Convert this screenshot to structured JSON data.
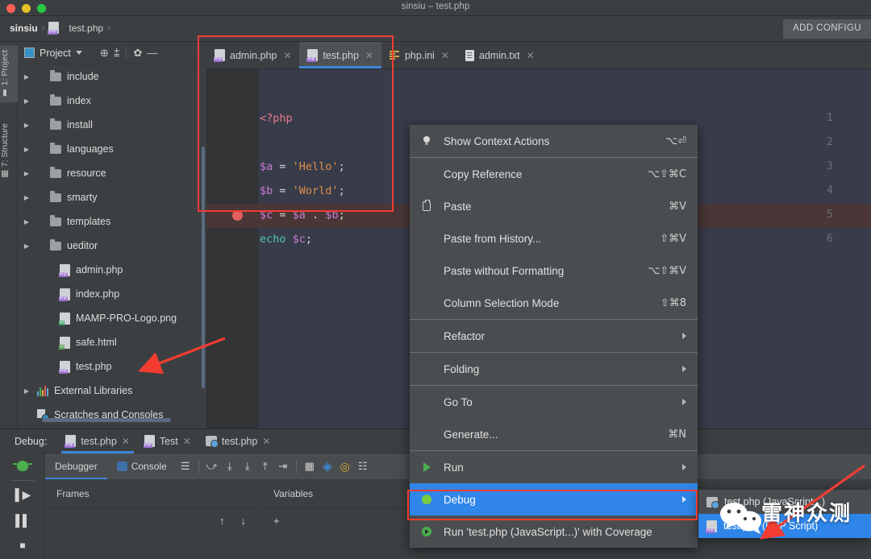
{
  "window": {
    "title": "sinsiu – test.php"
  },
  "breadcrumb": {
    "project": "sinsiu",
    "file": "test.php",
    "separator": "›"
  },
  "toolbar": {
    "add_configuration": "ADD CONFIGU"
  },
  "left_tool_strip": {
    "tabs": [
      {
        "label": "1: Project"
      },
      {
        "label": "7: Structure"
      }
    ]
  },
  "project_panel": {
    "title": "Project",
    "tree": [
      {
        "label": "include",
        "type": "folder",
        "expandable": true
      },
      {
        "label": "index",
        "type": "folder",
        "expandable": true
      },
      {
        "label": "install",
        "type": "folder",
        "expandable": true
      },
      {
        "label": "languages",
        "type": "folder",
        "expandable": true
      },
      {
        "label": "resource",
        "type": "folder",
        "expandable": true
      },
      {
        "label": "smarty",
        "type": "folder",
        "expandable": true
      },
      {
        "label": "templates",
        "type": "folder",
        "expandable": true
      },
      {
        "label": "ueditor",
        "type": "folder",
        "expandable": true
      },
      {
        "label": "admin.php",
        "type": "php",
        "expandable": false
      },
      {
        "label": "index.php",
        "type": "php",
        "expandable": false
      },
      {
        "label": "MAMP-PRO-Logo.png",
        "type": "png",
        "expandable": false
      },
      {
        "label": "safe.html",
        "type": "html",
        "expandable": false
      },
      {
        "label": "test.php",
        "type": "php",
        "expandable": false
      },
      {
        "label": "External Libraries",
        "type": "library",
        "expandable": true
      },
      {
        "label": "Scratches and Consoles",
        "type": "scratch",
        "expandable": false
      }
    ]
  },
  "editor": {
    "tabs": [
      {
        "label": "admin.php",
        "type": "php",
        "active": false
      },
      {
        "label": "test.php",
        "type": "php",
        "active": true
      },
      {
        "label": "php.ini",
        "type": "ini",
        "active": false
      },
      {
        "label": "admin.txt",
        "type": "txt",
        "active": false
      }
    ],
    "line_numbers": [
      "1",
      "2",
      "3",
      "4",
      "5",
      "6"
    ],
    "breakpoint_line": 5,
    "current_line": 5,
    "code": [
      {
        "n": "1",
        "tokens": [
          {
            "t": "<?php",
            "c": "tag"
          }
        ]
      },
      {
        "n": "2",
        "tokens": []
      },
      {
        "n": "3",
        "tokens": [
          {
            "t": "$a",
            "c": "var"
          },
          {
            "t": " = ",
            "c": "op"
          },
          {
            "t": "'Hello'",
            "c": "str"
          },
          {
            "t": ";",
            "c": "def"
          }
        ]
      },
      {
        "n": "4",
        "tokens": [
          {
            "t": "$b",
            "c": "var"
          },
          {
            "t": " = ",
            "c": "op"
          },
          {
            "t": "'World'",
            "c": "str"
          },
          {
            "t": ";",
            "c": "def"
          }
        ]
      },
      {
        "n": "5",
        "tokens": [
          {
            "t": "$c",
            "c": "var"
          },
          {
            "t": " = ",
            "c": "op"
          },
          {
            "t": "$a",
            "c": "var"
          },
          {
            "t": " . ",
            "c": "op"
          },
          {
            "t": "$b",
            "c": "var"
          },
          {
            "t": ";",
            "c": "def"
          }
        ]
      },
      {
        "n": "6",
        "tokens": [
          {
            "t": "echo",
            "c": "echo"
          },
          {
            "t": " ",
            "c": "def"
          },
          {
            "t": "$c",
            "c": "var"
          },
          {
            "t": ";",
            "c": "def"
          }
        ]
      }
    ]
  },
  "context_menu": {
    "items": [
      {
        "label": "Show Context Actions",
        "keys": "⌥⏎",
        "icon": "lightbulb-icon",
        "submenu": false,
        "selected": false
      },
      {
        "separator": true
      },
      {
        "label": "Copy Reference",
        "keys": "⌥⇧⌘C",
        "icon": "",
        "submenu": false,
        "selected": false
      },
      {
        "label": "Paste",
        "keys": "⌘V",
        "icon": "clipboard-icon",
        "submenu": false,
        "selected": false
      },
      {
        "label": "Paste from History...",
        "keys": "⇧⌘V",
        "icon": "",
        "submenu": false,
        "selected": false
      },
      {
        "label": "Paste without Formatting",
        "keys": "⌥⇧⌘V",
        "icon": "",
        "submenu": false,
        "selected": false
      },
      {
        "label": "Column Selection Mode",
        "keys": "⇧⌘8",
        "icon": "",
        "submenu": false,
        "selected": false
      },
      {
        "separator": true
      },
      {
        "label": "Refactor",
        "keys": "",
        "icon": "",
        "submenu": true,
        "selected": false
      },
      {
        "separator": true
      },
      {
        "label": "Folding",
        "keys": "",
        "icon": "",
        "submenu": true,
        "selected": false
      },
      {
        "separator": true
      },
      {
        "label": "Go To",
        "keys": "",
        "icon": "",
        "submenu": true,
        "selected": false
      },
      {
        "label": "Generate...",
        "keys": "⌘N",
        "icon": "",
        "submenu": false,
        "selected": false
      },
      {
        "separator": true
      },
      {
        "label": "Run",
        "keys": "",
        "icon": "run-icon",
        "submenu": true,
        "selected": false
      },
      {
        "label": "Debug",
        "keys": "",
        "icon": "debug-icon",
        "submenu": true,
        "selected": true
      },
      {
        "label": "Run 'test.php (JavaScript...)' with Coverage",
        "keys": "",
        "icon": "coverage-icon",
        "submenu": false,
        "selected": false
      }
    ]
  },
  "submenu": {
    "items": [
      {
        "label": "test.php (JavaScript...)",
        "type": "js",
        "selected": false
      },
      {
        "label": "test.php (PHP Script)",
        "type": "php",
        "selected": true
      }
    ]
  },
  "debug_panel": {
    "label": "Debug:",
    "session_tabs": [
      {
        "label": "test.php",
        "type": "php",
        "active": true
      },
      {
        "label": "Test",
        "type": "php",
        "active": false
      },
      {
        "label": "test.php",
        "type": "js",
        "active": false
      }
    ],
    "sub_tabs": [
      {
        "label": "Debugger",
        "active": true
      },
      {
        "label": "Console",
        "active": false
      }
    ],
    "panes": [
      {
        "title": "Frames"
      },
      {
        "title": "Variables"
      }
    ]
  },
  "watermark": {
    "text": "雷神众测"
  },
  "colors": {
    "accent_blue": "#2f86e8",
    "annotation_red": "#f23c32",
    "tab_underline": "#3d87d6",
    "editor_bg": "#383c4a",
    "panel_bg": "#3c3f41",
    "menu_bg": "#4a4d4f",
    "breakpoint": "#e35f5f",
    "current_line_bg": "#4a3636"
  }
}
